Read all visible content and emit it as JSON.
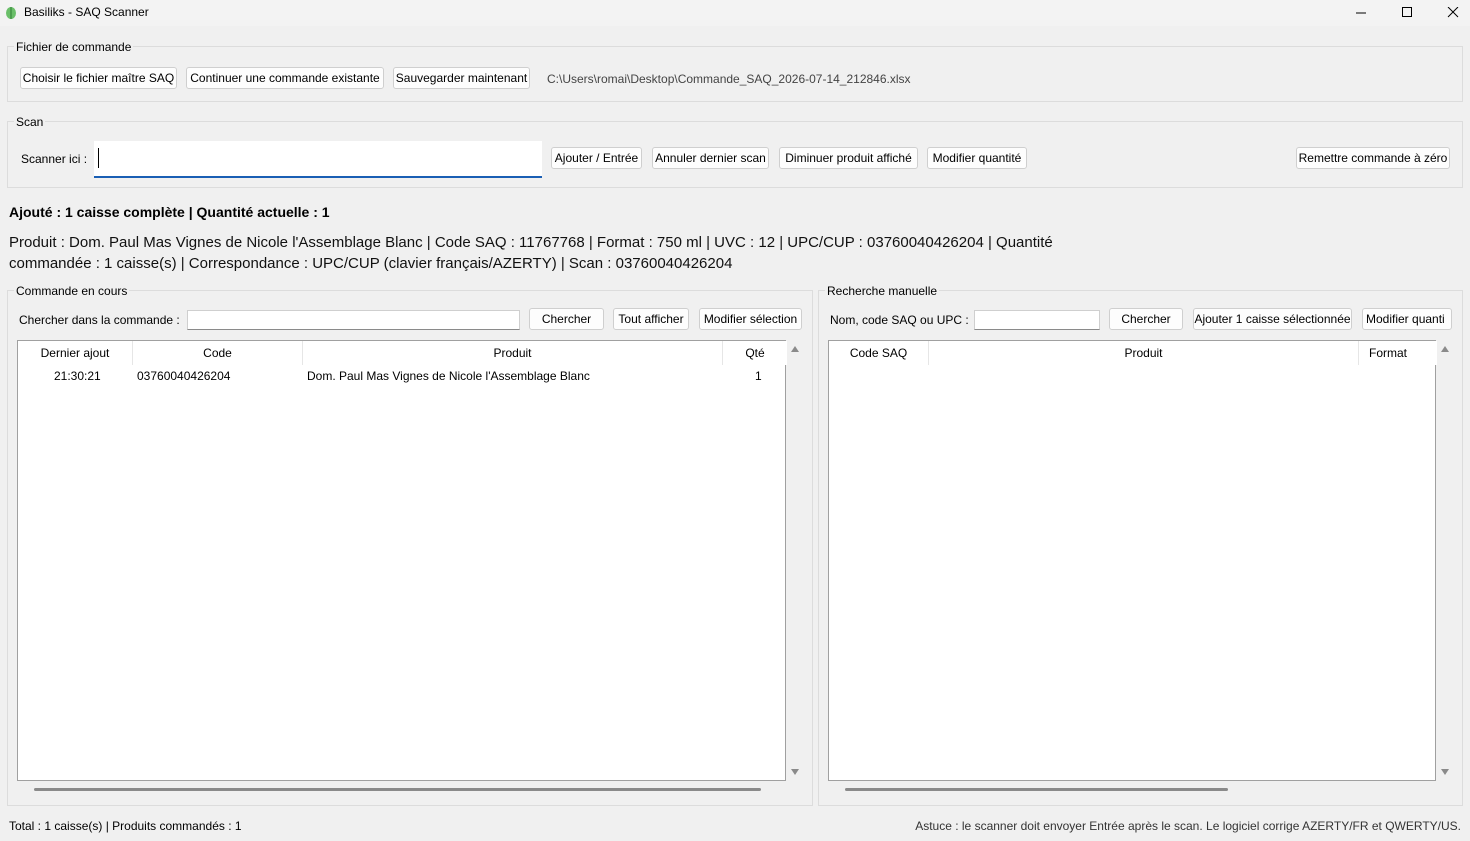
{
  "window": {
    "title": "Basiliks - SAQ Scanner"
  },
  "file_group": {
    "label": "Fichier de commande",
    "choose_master_label": "Choisir le fichier maître SAQ",
    "continue_order_label": "Continuer une commande existante",
    "save_now_label": "Sauvegarder maintenant",
    "file_path": "C:\\Users\\romai\\Desktop\\Commande_SAQ_2026-07-14_212846.xlsx"
  },
  "scan_group": {
    "label": "Scan",
    "scan_here_label": "Scanner ici :",
    "scan_value": "",
    "add_enter_label": "Ajouter / Entrée",
    "undo_last_label": "Annuler dernier scan",
    "decrease_label": "Diminuer produit affiché",
    "modify_qty_label": "Modifier quantité",
    "reset_label": "Remettre commande à zéro"
  },
  "status": {
    "added": "Ajouté : 1 caisse complète | Quantité actuelle : 1",
    "product_line1": "Produit : Dom. Paul Mas Vignes de Nicole l'Assemblage Blanc | Code SAQ : 11767768 | Format : 750 ml | UVC : 12 | UPC/CUP : 03760040426204 | Quantité",
    "product_line2": "commandée : 1 caisse(s) | Correspondance : UPC/CUP (clavier français/AZERTY) | Scan : 03760040426204"
  },
  "order_group": {
    "label": "Commande en cours",
    "search_label": "Chercher dans la commande :",
    "search_value": "",
    "search_button": "Chercher",
    "show_all_button": "Tout afficher",
    "modify_selection_button": "Modifier sélection",
    "columns": [
      "Dernier ajout",
      "Code",
      "Produit",
      "Qté"
    ],
    "rows": [
      [
        "21:30:21",
        "03760040426204",
        "Dom. Paul Mas Vignes de Nicole l'Assemblage Blanc",
        "1"
      ]
    ]
  },
  "manual_group": {
    "label": "Recherche manuelle",
    "search_label": "Nom, code SAQ ou UPC :",
    "search_value": "",
    "search_button": "Chercher",
    "add_case_button": "Ajouter 1 caisse sélectionnée",
    "modify_qty_button": "Modifier quanti",
    "columns": [
      "Code SAQ",
      "Produit",
      "Format"
    ],
    "rows": []
  },
  "footer": {
    "total": "Total : 1 caisse(s) | Produits commandés : 1",
    "tip": "Astuce : le scanner doit envoyer Entrée après le scan. Le logiciel corrige AZERTY/FR et QWERTY/US."
  },
  "colors": {
    "accent": "#1a5fb4",
    "background": "#f0f0f0",
    "icon_green": "#4caf50"
  },
  "icons": [
    "app-icon",
    "minimize-icon",
    "maximize-icon",
    "close-icon",
    "scroll-up-icon",
    "scroll-down-icon"
  ]
}
